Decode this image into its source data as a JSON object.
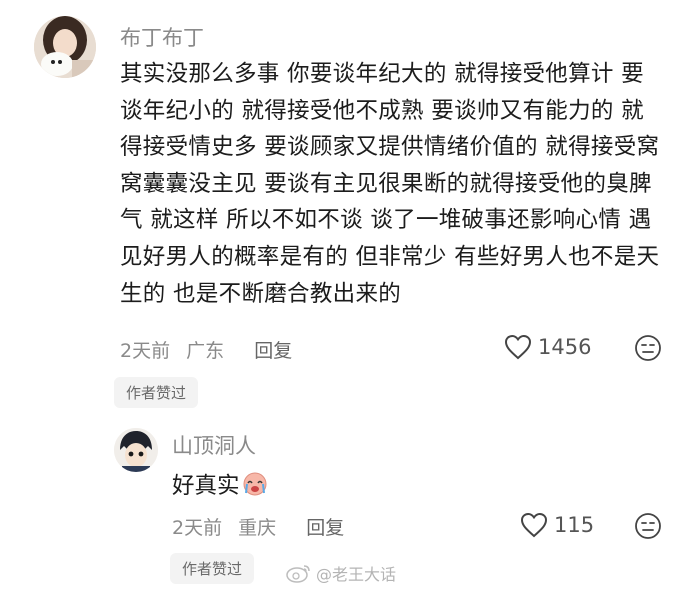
{
  "comment": {
    "username": "布丁布丁",
    "text": "其实没那么多事 你要谈年纪大的 就得接受他算计 要谈年纪小的 就得接受他不成熟 要谈帅又有能力的 就得接受情史多 要谈顾家又提供情绪价值的 就得接受窝窝囊囊没主见 要谈有主见很果断的就得接受他的臭脾气 就这样 所以不如不谈 谈了一堆破事还影响心情 遇见好男人的概率是有的 但非常少 有些好男人也不是天生的 也是不断磨合教出来的",
    "time": "2天前",
    "location": "广东",
    "reply_label": "回复",
    "likes": "1456",
    "badge": "作者赞过",
    "icons": {
      "avatar": "avatar-girl-with-dog",
      "like": "heart-outline-icon",
      "emoji": "neutral-face-icon"
    }
  },
  "reply": {
    "username": "山顶洞人",
    "text": "好真实",
    "time": "2天前",
    "location": "重庆",
    "reply_label": "回复",
    "likes": "115",
    "badge": "作者赞过",
    "icons": {
      "avatar": "avatar-anime-boy",
      "emoji_inline": "crying-face-emoji",
      "like": "heart-outline-icon",
      "emoji": "neutral-face-icon"
    }
  },
  "watermark": {
    "text": "@老王大话",
    "icon": "weibo-logo-icon"
  }
}
